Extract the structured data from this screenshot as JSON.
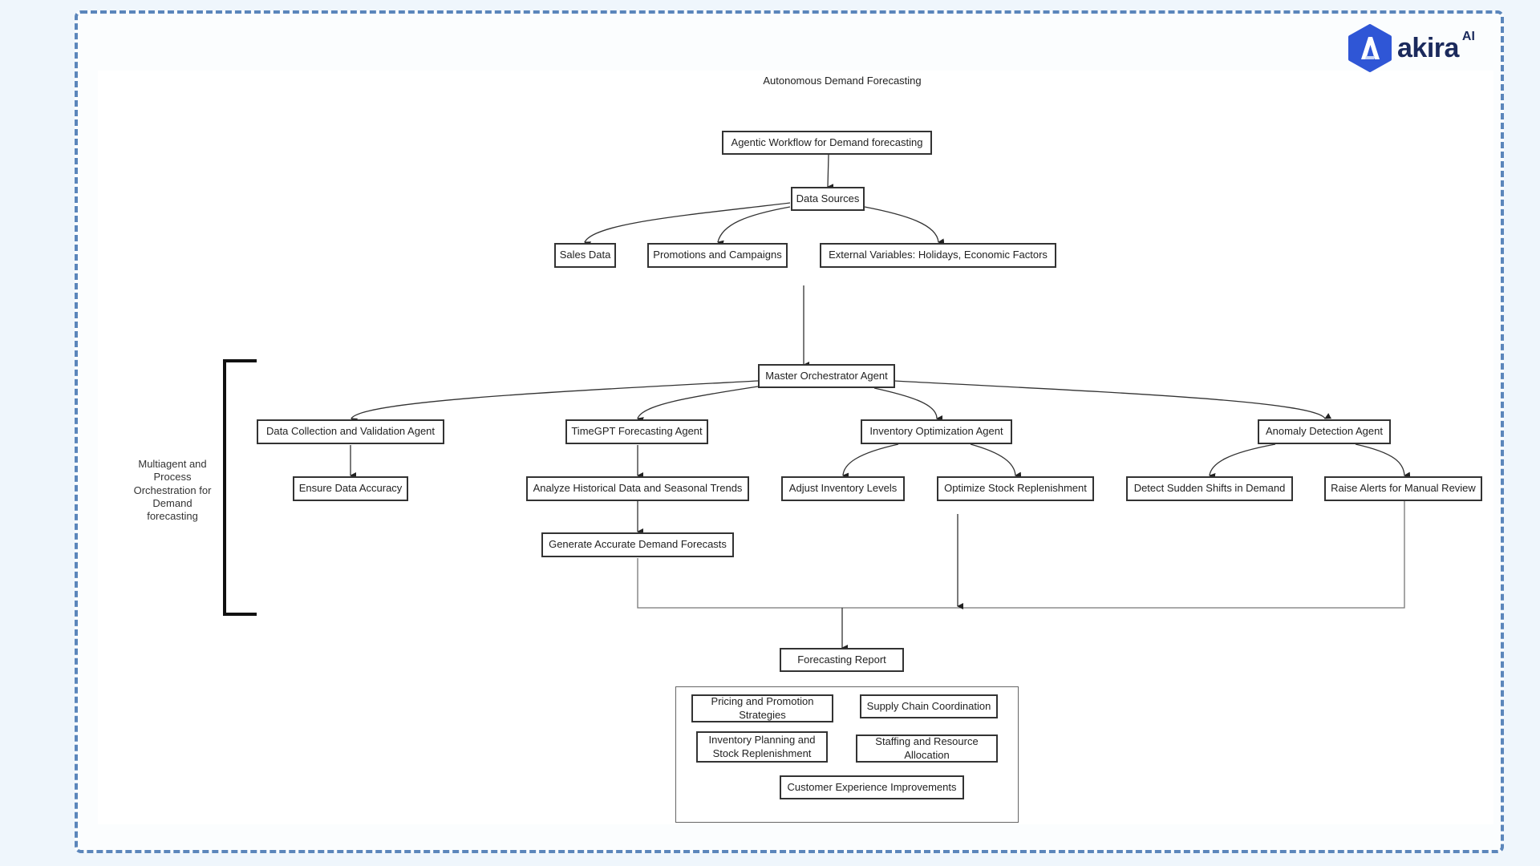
{
  "brand": {
    "name": "akira",
    "suffix": "AI",
    "color": "#2f56d6"
  },
  "diagram": {
    "title": "Autonomous Demand Forecasting",
    "side_label": "Multiagent and Process Orchestration for Demand forecasting",
    "nodes": {
      "workflow": "Agentic Workflow for Demand forecasting",
      "data_sources": "Data Sources",
      "sales_data": "Sales Data",
      "promotions": "Promotions and Campaigns",
      "external": "External Variables: Holidays, Economic Factors",
      "orchestrator": "Master Orchestrator Agent",
      "data_collection": "Data Collection and Validation Agent",
      "timegpt": "TimeGPT Forecasting Agent",
      "inventory": "Inventory Optimization Agent",
      "anomaly": "Anomaly Detection Agent",
      "ensure_accuracy": "Ensure Data Accuracy",
      "analyze_historical": "Analyze Historical Data and Seasonal Trends",
      "adjust_inventory": "Adjust Inventory Levels",
      "optimize_stock": "Optimize Stock Replenishment",
      "detect_shifts": "Detect Sudden Shifts in Demand",
      "raise_alerts": "Raise Alerts for Manual Review",
      "generate_forecasts": "Generate Accurate Demand Forecasts",
      "report": "Forecasting Report"
    },
    "outcomes": [
      "Pricing and Promotion Strategies",
      "Supply Chain Coordination",
      "Inventory Planning and Stock Replenishment",
      "Staffing and Resource Allocation",
      "Customer Experience Improvements"
    ]
  }
}
